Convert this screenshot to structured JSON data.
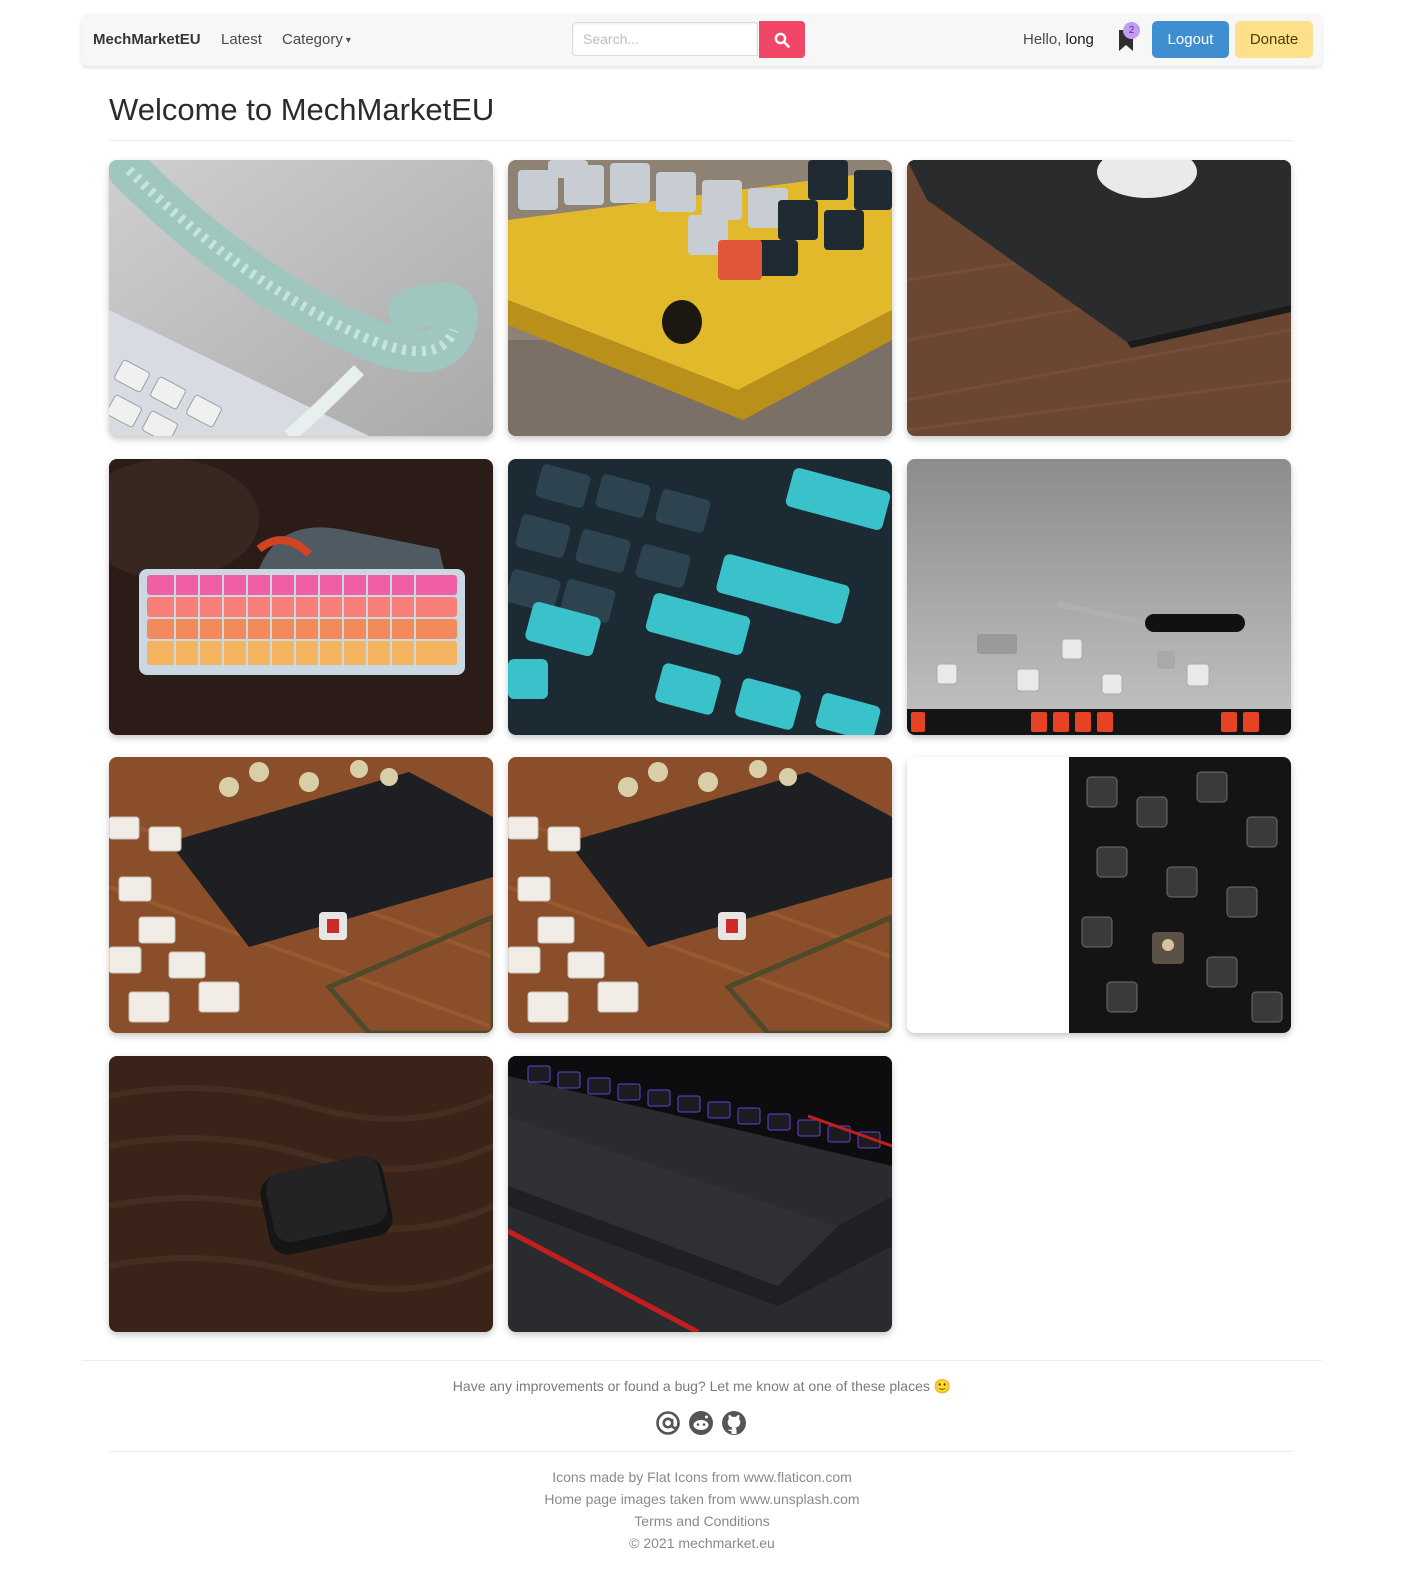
{
  "navbar": {
    "brand": "MechMarketEU",
    "latest_label": "Latest",
    "category_label": "Category",
    "search": {
      "placeholder": "Search...",
      "value": ""
    },
    "greeting_prefix": "Hello, ",
    "username": "long",
    "bookmark_count": "2",
    "logout_label": "Logout",
    "donate_label": "Donate"
  },
  "page": {
    "title": "Welcome to MechMarketEU"
  },
  "gallery": {
    "images": [
      "coiled-cable",
      "yellow-keyboard",
      "desk-mat",
      "pink-keyboard",
      "teal-keycaps",
      "keycaps-puller",
      "keyboard-pcb",
      "keyboard-pcb",
      "switches",
      "keyboard-case",
      "redragon-keyboard"
    ]
  },
  "footer": {
    "message": "Have any improvements or found a bug? Let me know at one of these places",
    "emoji": "🙂",
    "icons": [
      "at-icon",
      "reddit-icon",
      "github-icon"
    ],
    "credits": {
      "icons": "Icons made by Flat Icons from www.flaticon.com",
      "images": "Home page images taken from www.unsplash.com",
      "terms": "Terms and Conditions",
      "copyright": "© 2021 mechmarket.eu"
    }
  },
  "colors": {
    "search_button": "#f14668",
    "logout_button": "#3e8ed0",
    "donate_button": "#ffe08a",
    "badge": "#c39cf5"
  }
}
